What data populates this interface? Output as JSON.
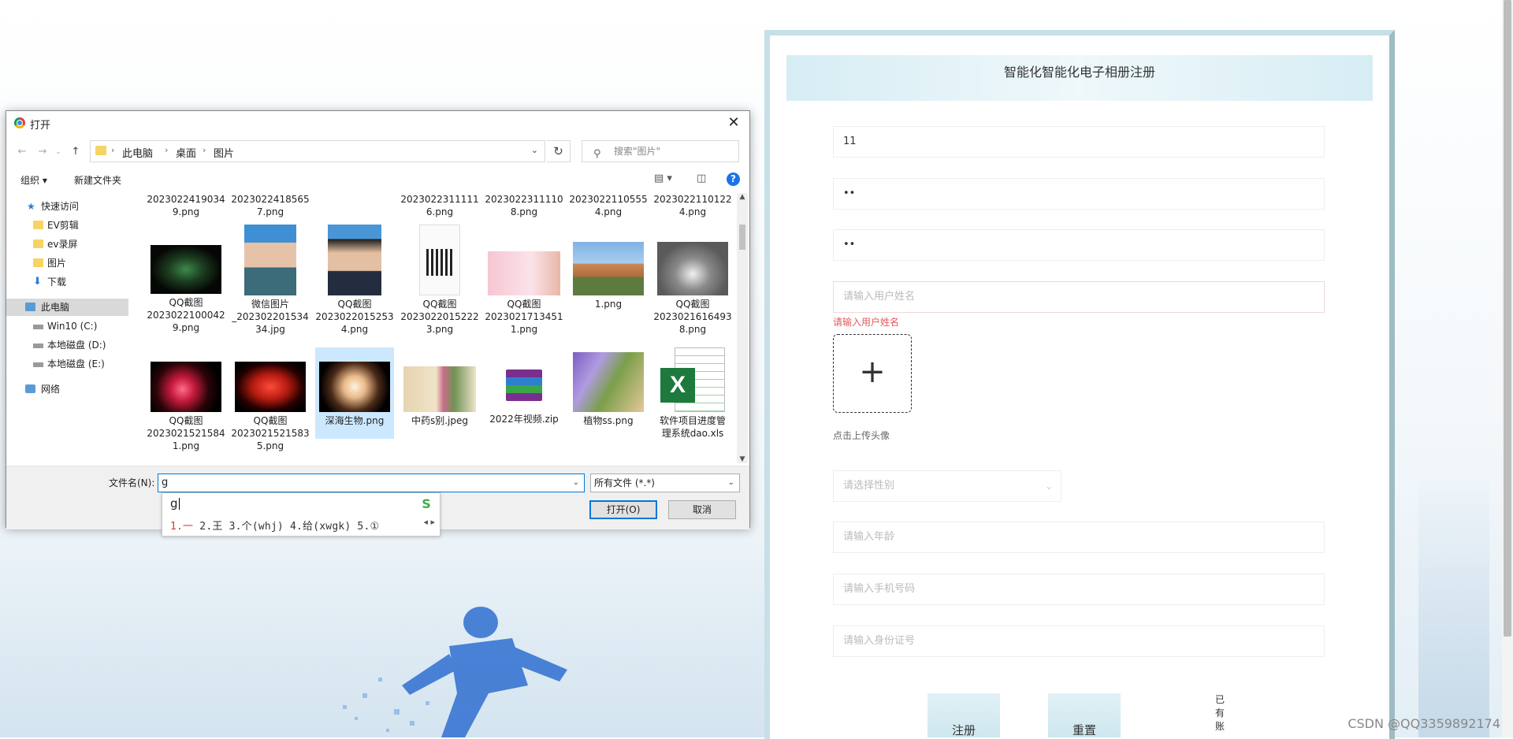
{
  "registration": {
    "title": "智能化智能化电子相册注册",
    "fields": [
      {
        "value": "11",
        "placeholder": ""
      },
      {
        "value": "••",
        "placeholder": ""
      },
      {
        "value": "••",
        "placeholder": ""
      },
      {
        "value": "",
        "placeholder": "请输入用户姓名"
      }
    ],
    "error": "请输入用户姓名",
    "avatar_plus": "+",
    "avatar_hint": "点击上传头像",
    "gender_placeholder": "请选择性别",
    "age_placeholder": "请输入年龄",
    "phone_placeholder": "请输入手机号码",
    "id_placeholder": "请输入身份证号",
    "register_button": "注册",
    "reset_button": "重置",
    "login_link": "已有账"
  },
  "dialog": {
    "title": "打开",
    "breadcrumbs": [
      "此电脑",
      "桌面",
      "图片"
    ],
    "search_placeholder": "搜索\"图片\"",
    "toolbar": {
      "organize": "组织",
      "new_folder": "新建文件夹"
    },
    "sidebar": [
      {
        "label": "快速访问",
        "icon": "star-icon"
      },
      {
        "label": "EV剪辑",
        "icon": "folder-icon"
      },
      {
        "label": "ev录屏",
        "icon": "folder-icon"
      },
      {
        "label": "图片",
        "icon": "folder-icon"
      },
      {
        "label": "下载",
        "icon": "download-icon"
      },
      {
        "label": "此电脑",
        "icon": "computer-icon"
      },
      {
        "label": "Win10 (C:)",
        "icon": "drive-icon"
      },
      {
        "label": "本地磁盘 (D:)",
        "icon": "drive-icon"
      },
      {
        "label": "本地磁盘 (E:)",
        "icon": "drive-icon"
      },
      {
        "label": "网络",
        "icon": "network-icon"
      }
    ],
    "files_row0": [
      {
        "name": "2023022419034\n9.png"
      },
      {
        "name": "2023022418565\n7.png"
      },
      {
        "name": ""
      },
      {
        "name": "2023022311111\n6.png"
      },
      {
        "name": "2023022311110\n8.png"
      },
      {
        "name": "2023022110555\n4.png"
      },
      {
        "name": "2023022110122\n4.png"
      }
    ],
    "files_row1": [
      {
        "name": "QQ截图\n2023022100042\n9.png"
      },
      {
        "name": "微信图片\n_202302201534\n34.jpg"
      },
      {
        "name": "QQ截图\n2023022015253\n4.png"
      },
      {
        "name": "QQ截图\n2023022015222\n3.png"
      },
      {
        "name": "QQ截图\n2023021713451\n1.png"
      },
      {
        "name": "1.png"
      },
      {
        "name": "QQ截图\n2023021616493\n8.png"
      }
    ],
    "files_row2": [
      {
        "name": "QQ截图\n2023021521584\n1.png"
      },
      {
        "name": "QQ截图\n2023021521583\n5.png"
      },
      {
        "name": "深海生物.png"
      },
      {
        "name": "中药s别.jpeg"
      },
      {
        "name": "2022年视频.zip"
      },
      {
        "name": "植物ss.png"
      },
      {
        "name": "软件项目进度管\n理系统dao.xls"
      }
    ],
    "filename_label": "文件名(N):",
    "filename_value": "g",
    "filetype": "所有文件 (*.*)",
    "open_button": "打开(O)",
    "cancel_button": "取消"
  },
  "ime": {
    "composition": "g",
    "first": "1.一",
    "rest": "2.王  3.个(whj)  4.给(xwgk)  5.①"
  },
  "watermark": "CSDN @QQ3359892174"
}
